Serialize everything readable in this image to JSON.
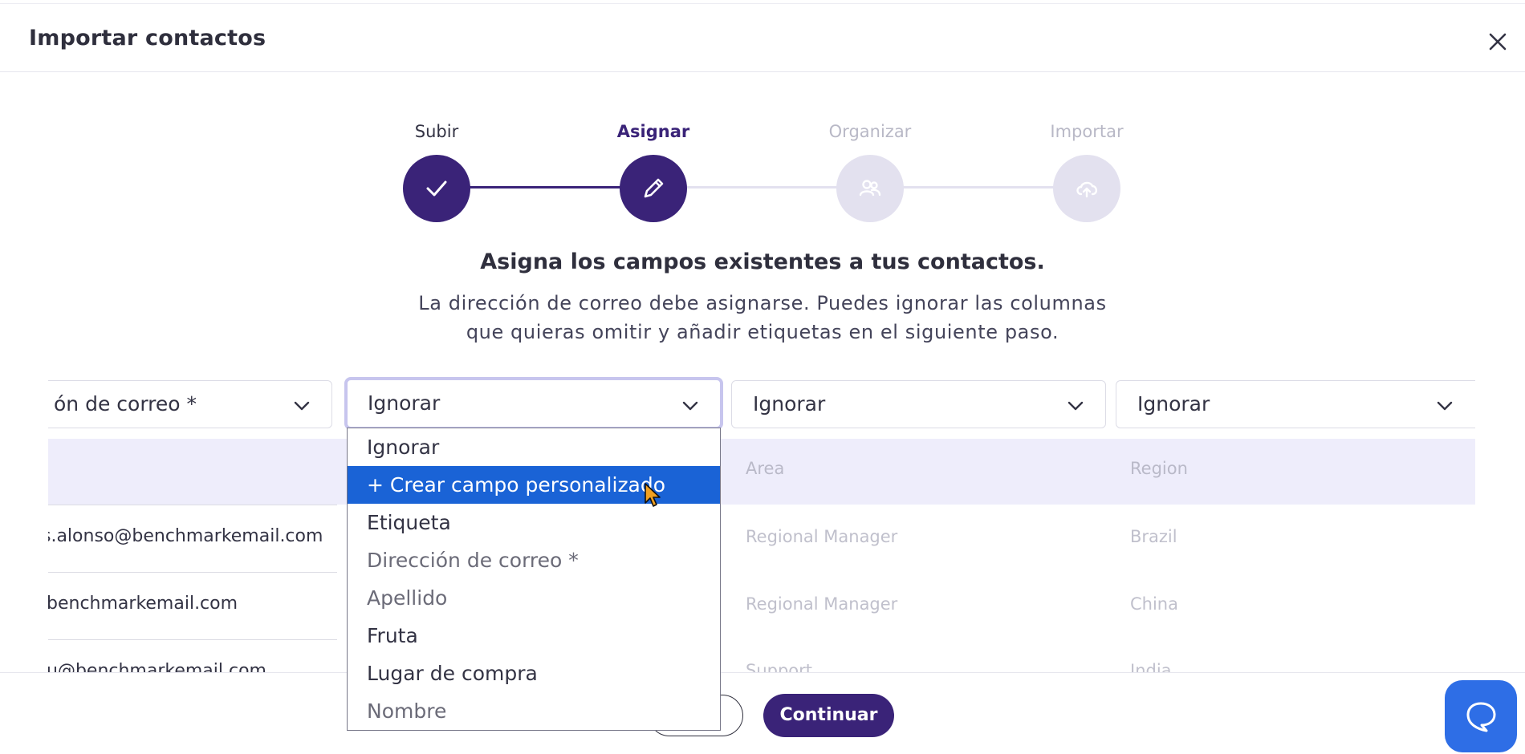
{
  "dialog": {
    "title": "Importar contactos"
  },
  "steps": [
    {
      "label": "Subir",
      "state": "done",
      "icon": "check-icon"
    },
    {
      "label": "Asignar",
      "state": "active",
      "icon": "pencil-icon"
    },
    {
      "label": "Organizar",
      "state": "todo",
      "icon": "users-icon"
    },
    {
      "label": "Importar",
      "state": "todo",
      "icon": "cloud-upload-icon"
    }
  ],
  "instructions": {
    "heading": "Asigna los campos existentes a tus contactos.",
    "line1": "La dirección de correo debe asignarse. Puedes ignorar las columnas",
    "line2": "que quieras omitir y añadir etiquetas en el siguiente paso."
  },
  "mapping": {
    "selects": [
      "ón de correo *",
      "Ignorar",
      "Ignorar",
      "Ignorar"
    ],
    "headers": [
      "",
      "",
      "Area",
      "Region"
    ],
    "rows": [
      {
        "email": "s.alonso@benchmarkemail.com",
        "area": "Regional Manager",
        "region": "Brazil"
      },
      {
        "email": "benchmarkemail.com",
        "area": "Regional Manager",
        "region": "China"
      },
      {
        "email": "u@benchmarkemail.com",
        "area": "Support",
        "region": "India"
      }
    ]
  },
  "dropdown": {
    "options": [
      "Ignorar",
      "+ Crear campo personalizado",
      "Etiqueta",
      "Dirección de correo *",
      "Apellido",
      "Fruta",
      "Lugar de compra",
      "Nombre"
    ],
    "highlighted_index": 1
  },
  "footer": {
    "continue_label": "Continuar"
  },
  "colors": {
    "primary": "#3a2378",
    "step_inactive": "#e3e1ef",
    "table_header_bg": "#eeedfb",
    "option_highlight": "#1a63d6",
    "chat_button": "#2e6ee6"
  }
}
